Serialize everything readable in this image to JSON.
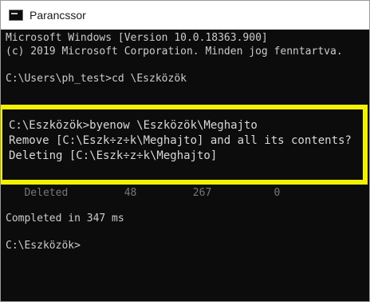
{
  "window": {
    "title": "Parancssor",
    "icon": "command-prompt-icon"
  },
  "console": {
    "lines": {
      "l1": "Microsoft Windows [Version 10.0.18363.900]",
      "l2": "(c) 2019 Microsoft Corporation. Minden jog fenntartva.",
      "l3": "C:\\Users\\ph_test>cd \\Eszközök",
      "deleted_row": "   Deleted         48         267          0",
      "completed": "Completed in 347 ms",
      "prompt_end": "C:\\Eszközök>"
    },
    "highlighted": {
      "h1": "C:\\Eszközök>byenow \\Eszközök\\Meghajto",
      "h2": "Remove [C:\\Eszk÷z÷k\\Meghajto] and all its contents?",
      "h3": "Deleting [C:\\Eszk÷z÷k\\Meghajto]"
    }
  },
  "colors": {
    "console_bg": "#0c0c0c",
    "console_text": "#cccccc",
    "highlight_border": "#f2f200"
  }
}
